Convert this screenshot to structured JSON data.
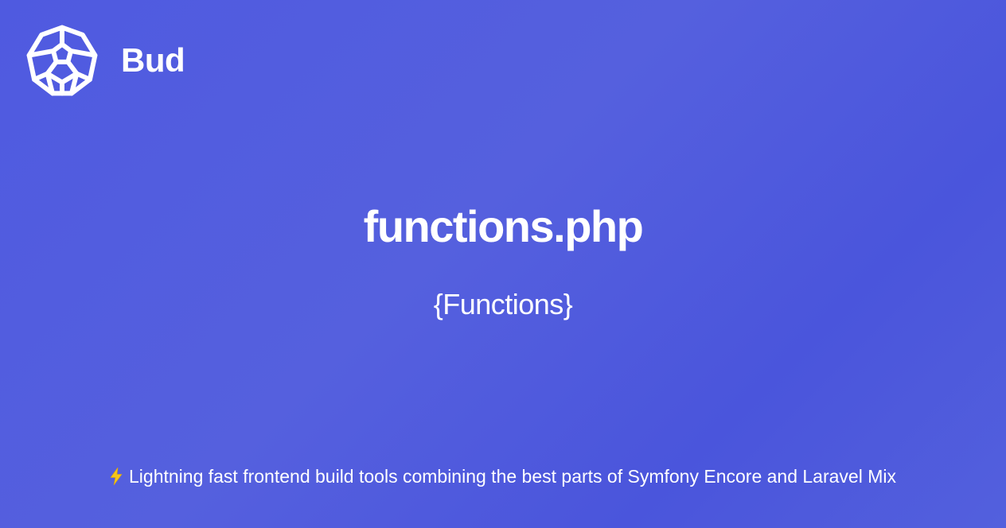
{
  "brand": {
    "name": "Bud",
    "logo_icon": "honeycomb-logo-icon"
  },
  "title": "functions.php",
  "subtitle": "{Functions}",
  "tagline": {
    "icon": "lightning-bolt-icon",
    "text": "Lightning fast frontend build tools combining the best parts of Symfony Encore and Laravel Mix"
  },
  "colors": {
    "background": "#5059df",
    "text": "#ffffff",
    "bolt": "#f5c518"
  }
}
